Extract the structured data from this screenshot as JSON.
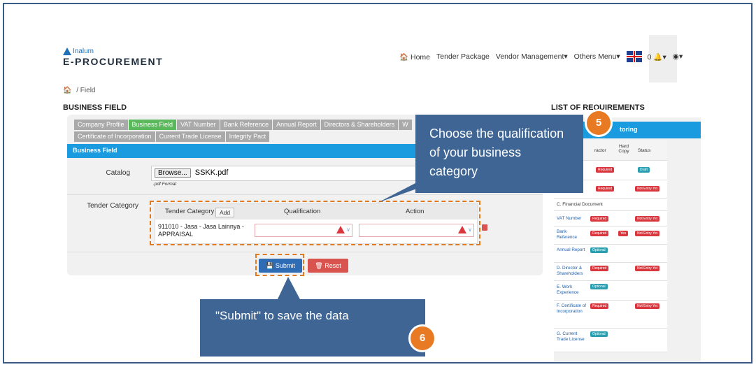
{
  "header": {
    "logo_small": "Inalum",
    "logo_main": "E-PROCUREMENT",
    "nav": {
      "home": "Home",
      "tender_package": "Tender Package",
      "vendor_management": "Vendor Management",
      "others_menu": "Others Menu",
      "notif_count": "0"
    }
  },
  "breadcrumb": {
    "current": "Field"
  },
  "page_title": "BUSINESS FIELD",
  "requirements_title": "LIST OF REQUIREMENTS",
  "tabs": [
    "Company Profile",
    "Business Field",
    "VAT Number",
    "Bank Reference",
    "Annual Report",
    "Directors & Shareholders",
    "W",
    "Certificate of Incorporation",
    "Current Trade License",
    "Integrity Pact"
  ],
  "form": {
    "section_title": "Business Field",
    "catalog_label": "Catalog",
    "browse_label": "Browse...",
    "file_name": "SSKK.pdf",
    "file_hint": ".pdf Format",
    "tender_category_label": "Tender Category",
    "table_headers": {
      "category": "Tender Category",
      "add": "Add",
      "qualification": "Qualification",
      "action": "Action"
    },
    "row_category": "911010 - Jasa - Jasa Lainnya - APPRAISAL",
    "submit_label": "Submit",
    "reset_label": "Reset"
  },
  "requirements": {
    "bar_title": "toring",
    "col_contractor": "ractor",
    "col_hardcopy": "Hard Copy",
    "col_status": "Status",
    "rows": [
      {
        "name": "",
        "req": "Required",
        "status": "Draft"
      },
      {
        "name": "",
        "req": "Required",
        "status": "Not Entry Yet"
      },
      {
        "name": "C. Financial Document"
      },
      {
        "name": "VAT Number",
        "req": "Required",
        "status": "Not Entry Yet"
      },
      {
        "name": "Bank Reference",
        "req": "Required",
        "hard": "Yes",
        "status": "Not Entry Yet"
      },
      {
        "name": "Annual Report",
        "req": "Optional"
      },
      {
        "name": "D. Director & Shareholders",
        "req": "Required",
        "status": "Not Entry Yet"
      },
      {
        "name": "E. Work Experience",
        "req": "Optional"
      },
      {
        "name": "F. Certificate of Incorporation",
        "req": "Required",
        "status": "Not Entry Yet"
      },
      {
        "name": "G. Current Trade License",
        "req": "Optional"
      }
    ]
  },
  "callouts": {
    "step5_text": "Choose the qualification of your  business category",
    "step5_num": "5",
    "step6_text": "\"Submit\" to save the data",
    "step6_num": "6"
  },
  "colors": {
    "accent_blue": "#1a9be0",
    "callout": "#3e6594",
    "orange": "#e87a24",
    "active_tab": "#5cb85c"
  }
}
